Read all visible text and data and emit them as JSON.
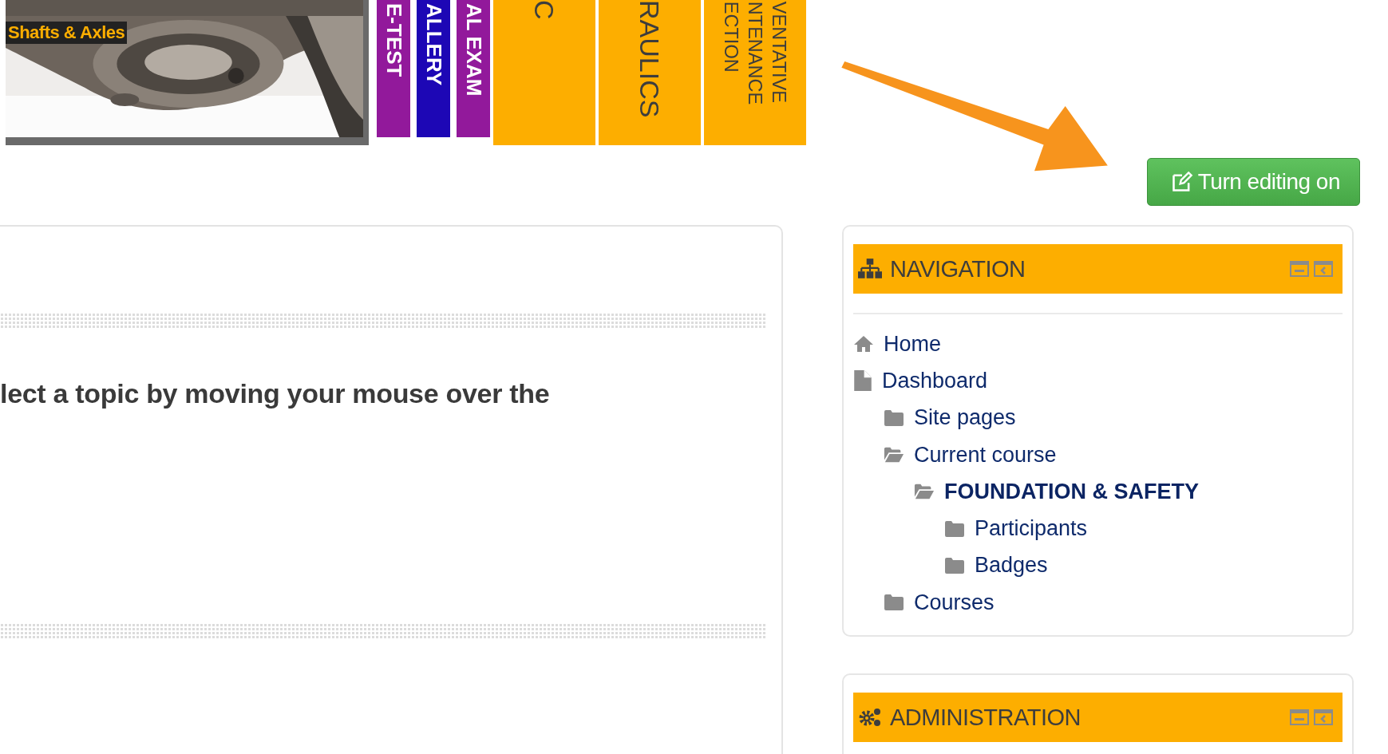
{
  "banner": {
    "caption": "Shafts & Axles",
    "tabs": [
      {
        "lines": [
          "E-TEST"
        ],
        "color": "#92199b"
      },
      {
        "lines": [
          "ALLERY"
        ],
        "color": "#1d07b5"
      },
      {
        "lines": [
          "AL EXAM"
        ],
        "color": "#92199b"
      },
      {
        "lines": [
          "C"
        ],
        "color": "#fdae00"
      },
      {
        "lines": [
          "RAULICS"
        ],
        "color": "#fdae00"
      },
      {
        "lines": [
          "VENTATIVE",
          "NTENANCE",
          "ECTION"
        ],
        "color": "#fdae00"
      }
    ]
  },
  "edit_button": {
    "label": "Turn editing on"
  },
  "main": {
    "text": "lect a topic by moving your mouse over the"
  },
  "navigation": {
    "title": "NAVIGATION",
    "items": [
      {
        "label": "Home",
        "kind": "home",
        "selected": false
      },
      {
        "label": "Dashboard",
        "kind": "page",
        "selected": false,
        "children": [
          {
            "label": "Site pages",
            "kind": "folder",
            "selected": false
          },
          {
            "label": "Current course",
            "kind": "branch",
            "selected": false,
            "children": [
              {
                "label": "FOUNDATION & SAFETY",
                "kind": "branch",
                "selected": true,
                "children": [
                  {
                    "label": "Participants",
                    "kind": "folder",
                    "selected": false
                  },
                  {
                    "label": "Badges",
                    "kind": "folder",
                    "selected": false
                  }
                ]
              }
            ]
          },
          {
            "label": "Courses",
            "kind": "folder",
            "selected": false
          }
        ]
      }
    ]
  },
  "administration": {
    "title": "ADMINISTRATION"
  }
}
